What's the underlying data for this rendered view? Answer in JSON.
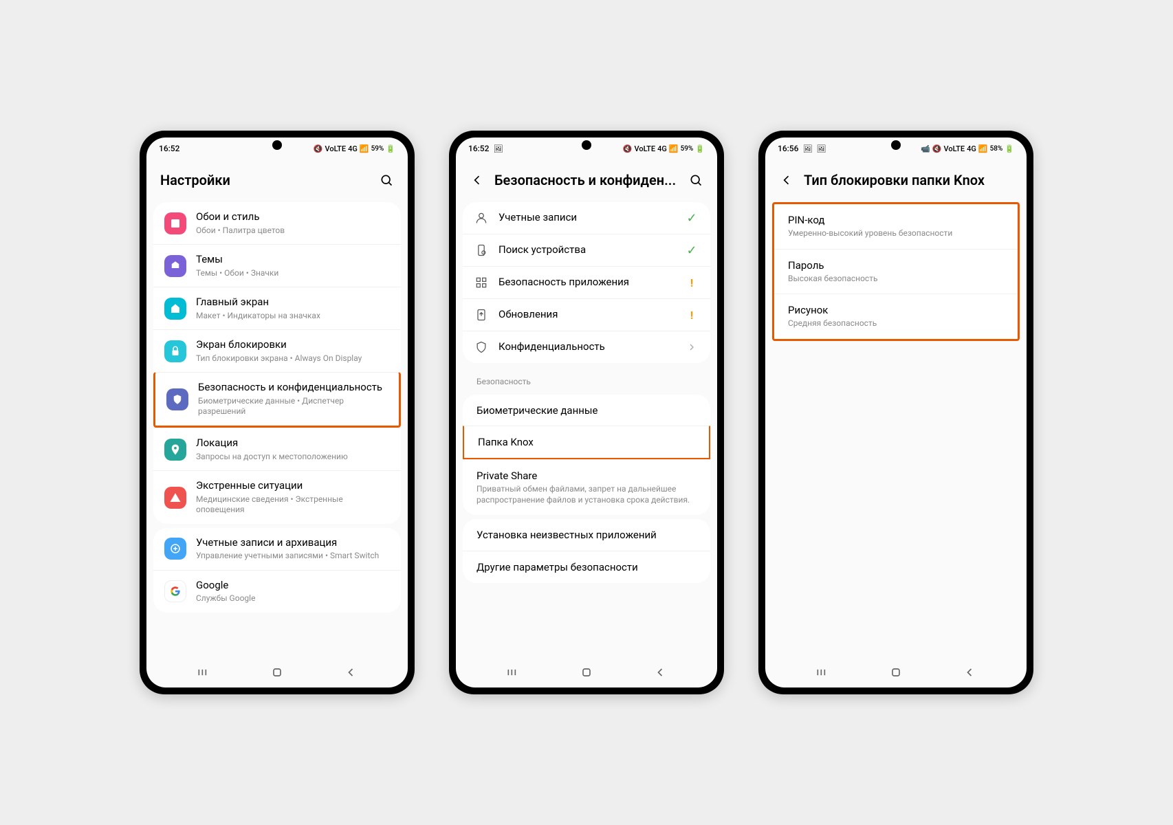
{
  "phone1": {
    "statusbar": {
      "time": "16:52",
      "battery": "59%",
      "net": "4G"
    },
    "header": {
      "title": "Настройки"
    },
    "items": [
      {
        "title": "Обои и стиль",
        "sub": "Обои • Палитра цветов"
      },
      {
        "title": "Темы",
        "sub": "Темы • Обои • Значки"
      },
      {
        "title": "Главный экран",
        "sub": "Макет • Индикаторы на значках"
      },
      {
        "title": "Экран блокировки",
        "sub": "Тип блокировки экрана • Always On Display"
      },
      {
        "title": "Безопасность и конфиденциальность",
        "sub": "Биометрические данные • Диспетчер разрешений"
      },
      {
        "title": "Локация",
        "sub": "Запросы на доступ к местоположению"
      },
      {
        "title": "Экстренные ситуации",
        "sub": "Медицинские сведения • Экстренные оповещения"
      },
      {
        "title": "Учетные записи и архивация",
        "sub": "Управление учетными записями • Smart Switch"
      },
      {
        "title": "Google",
        "sub": "Службы Google"
      }
    ]
  },
  "phone2": {
    "statusbar": {
      "time": "16:52",
      "battery": "59%",
      "net": "4G"
    },
    "header": {
      "title": "Безопасность и конфиден..."
    },
    "items": [
      {
        "title": "Учетные записи"
      },
      {
        "title": "Поиск устройства"
      },
      {
        "title": "Безопасность приложения"
      },
      {
        "title": "Обновления"
      },
      {
        "title": "Конфиденциальность"
      }
    ],
    "sectionLabel": "Безопасность",
    "secItems": [
      {
        "title": "Биометрические данные"
      },
      {
        "title": "Папка Knox"
      },
      {
        "title": "Private Share",
        "sub": "Приватный обмен файлами, запрет на дальнейшее распространение файлов и установка срока действия."
      },
      {
        "title": "Установка неизвестных приложений"
      },
      {
        "title": "Другие параметры безопасности"
      }
    ]
  },
  "phone3": {
    "statusbar": {
      "time": "16:56",
      "battery": "58%",
      "net": "4G"
    },
    "header": {
      "title": "Тип блокировки папки Knox"
    },
    "items": [
      {
        "title": "PIN-код",
        "sub": "Умеренно-высокий уровень безопасности"
      },
      {
        "title": "Пароль",
        "sub": "Высокая безопасность"
      },
      {
        "title": "Рисунок",
        "sub": "Средняя безопасность"
      }
    ]
  }
}
